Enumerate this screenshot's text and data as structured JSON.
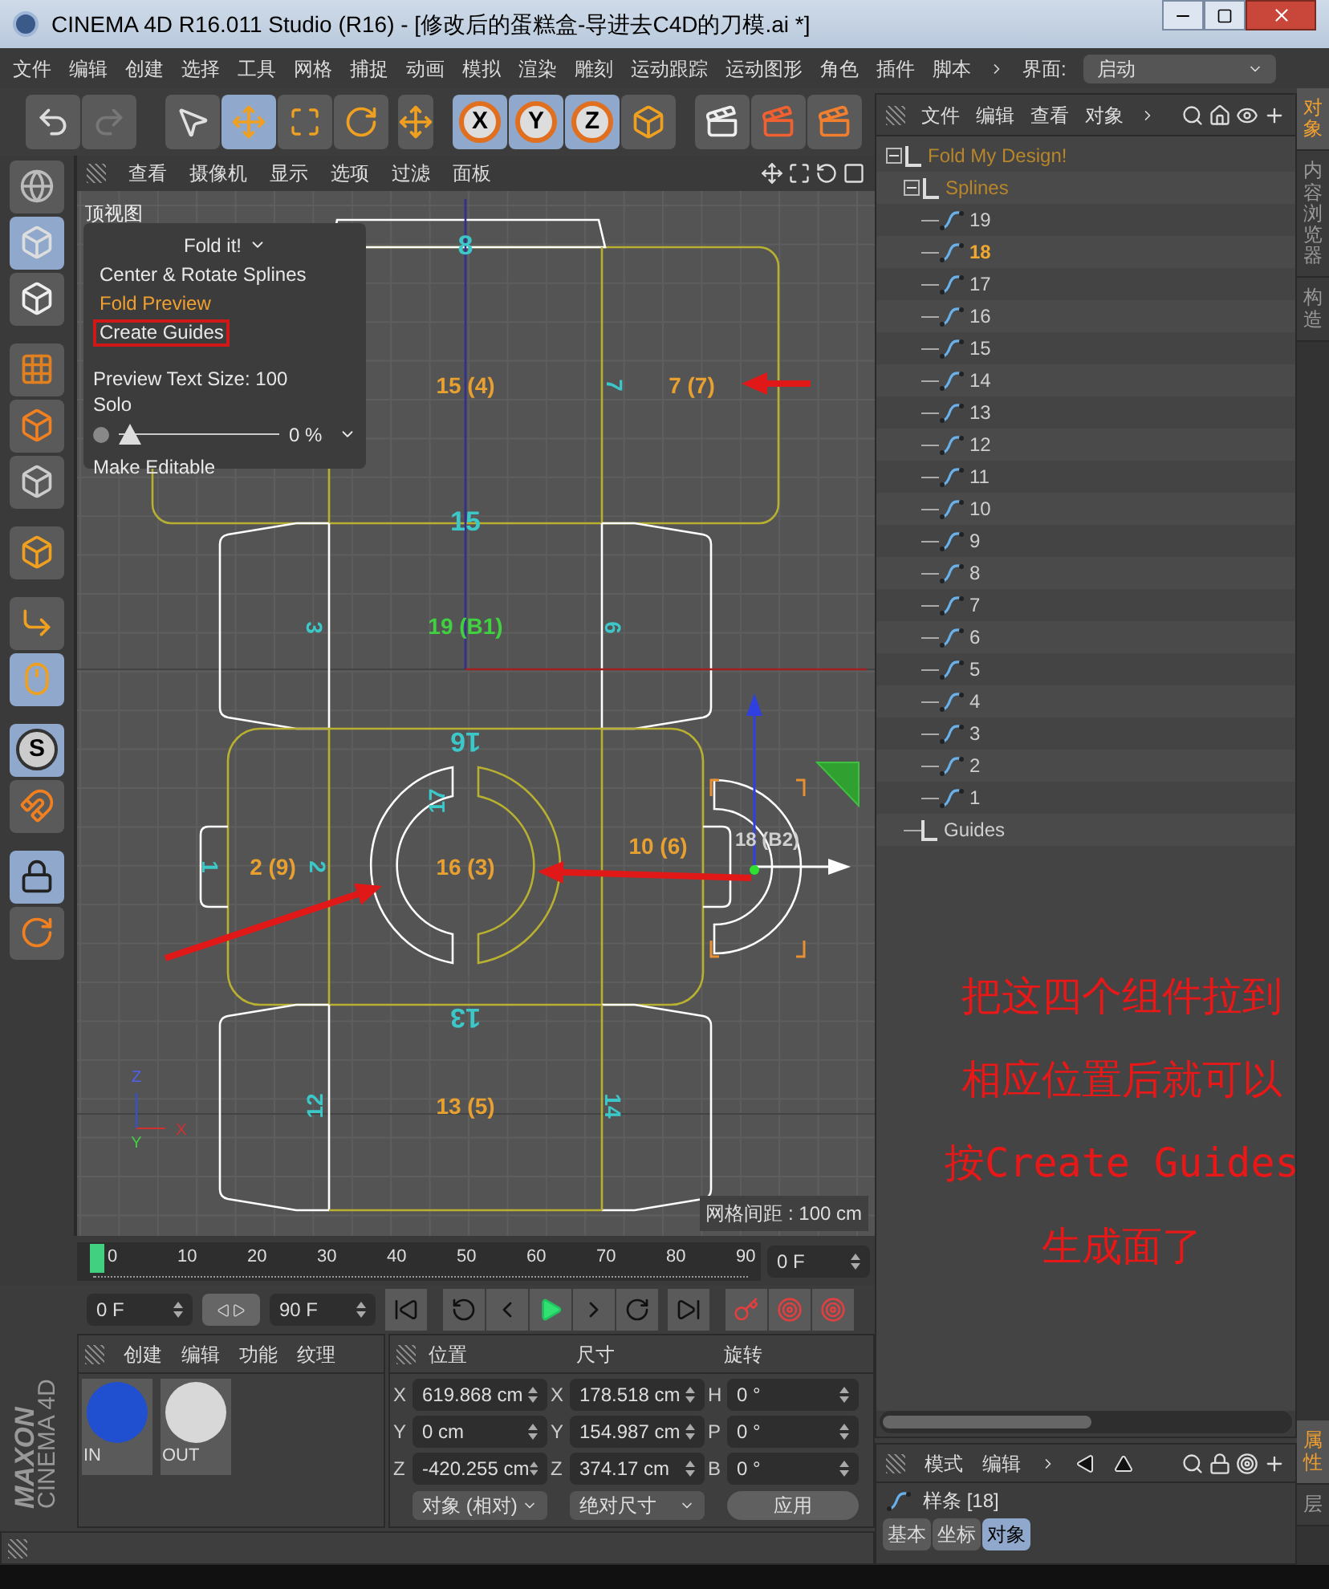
{
  "window": {
    "title": "CINEMA 4D R16.011 Studio (R16) - [修改后的蛋糕盒-导进去C4D的刀模.ai *]"
  },
  "menu": {
    "items": [
      "文件",
      "编辑",
      "创建",
      "选择",
      "工具",
      "网格",
      "捕捉",
      "动画",
      "模拟",
      "渲染",
      "雕刻",
      "运动跟踪",
      "运动图形",
      "角色",
      "插件",
      "脚本"
    ],
    "layout_label": "界面:",
    "layout_value": "启动"
  },
  "toolbar": {
    "tools": [
      {
        "selected": false
      },
      {
        "selected": true
      },
      {
        "selected": false
      },
      {
        "selected": false
      }
    ],
    "axes": [
      {
        "label": "X",
        "selected": true
      },
      {
        "label": "Y",
        "selected": true
      },
      {
        "label": "Z",
        "selected": true
      }
    ]
  },
  "left_tools": [
    {
      "selected": false
    },
    {
      "selected": true
    },
    {
      "selected": false
    },
    {
      "selected": false
    },
    {
      "selected": false
    },
    {
      "selected": false
    },
    {
      "selected": false
    },
    {
      "selected": false
    },
    {
      "selected": true
    },
    {
      "selected": true,
      "label": "S"
    },
    {
      "selected": false
    },
    {
      "selected": true
    },
    {
      "selected": false
    }
  ],
  "viewport": {
    "menu": [
      "查看",
      "摄像机",
      "显示",
      "选项",
      "过滤",
      "面板"
    ],
    "view_name": "顶视图",
    "grid_note": "网格间距 : 100 cm",
    "labels": [
      {
        "text": "8",
        "color": "#3cc8c8"
      },
      {
        "text": "15 (4)",
        "color": "#e8a030"
      },
      {
        "text": "7",
        "color": "#3cc8c8"
      },
      {
        "text": "7 (7)",
        "color": "#e8a030"
      },
      {
        "text": "15",
        "color": "#3cc8c8"
      },
      {
        "text": "3",
        "color": "#3cc8c8"
      },
      {
        "text": "19 (B1)",
        "color": "#40d040"
      },
      {
        "text": "6",
        "color": "#3cc8c8"
      },
      {
        "text": "16",
        "color": "#3cc8c8"
      },
      {
        "text": "17",
        "color": "#3cc8c8"
      },
      {
        "text": "1",
        "color": "#3cc8c8"
      },
      {
        "text": "2 (9)",
        "color": "#e8a030"
      },
      {
        "text": "2",
        "color": "#3cc8c8"
      },
      {
        "text": "16 (3)",
        "color": "#e8a030"
      },
      {
        "text": "10 (6)",
        "color": "#e8a030"
      },
      {
        "text": "18 (B2)",
        "color": "#d0d0d0"
      },
      {
        "text": "13",
        "color": "#3cc8c8"
      },
      {
        "text": "12",
        "color": "#3cc8c8"
      },
      {
        "text": "13 (5)",
        "color": "#e8a030"
      },
      {
        "text": "14",
        "color": "#3cc8c8"
      }
    ],
    "axis_letters": [
      "Z",
      "Y",
      "X"
    ],
    "fold_panel": {
      "title": "Fold it!",
      "items": [
        {
          "label": "Center & Rotate Splines",
          "selected": false,
          "highlighted": false
        },
        {
          "label": "Fold Preview",
          "selected": true,
          "highlighted": false
        },
        {
          "label": "Create Guides",
          "selected": false,
          "highlighted": true
        }
      ],
      "text_size": "Preview Text Size: 100",
      "solo": "Solo",
      "slider": {
        "level": 0,
        "reading": "0 %"
      },
      "make_editable": "Make Editable"
    }
  },
  "annotation": [
    "把这四个组件拉到",
    "相应位置后就可以",
    "按Create Guides",
    "生成面了"
  ],
  "timeline": {
    "ticks": [
      "0",
      "10",
      "20",
      "30",
      "40",
      "50",
      "60",
      "70",
      "80",
      "90"
    ],
    "playhead": {
      "level": 0
    },
    "current": "0 F"
  },
  "transport": {
    "start": "0 F",
    "end": "90 F"
  },
  "materials": {
    "menu": [
      "创建",
      "编辑",
      "功能",
      "纹理"
    ],
    "items": [
      {
        "name": "IN",
        "color": "#2050d0"
      },
      {
        "name": "OUT",
        "color": "#d8d8d8"
      }
    ]
  },
  "coordinates": {
    "headers": [
      "位置",
      "尺寸",
      "旋转"
    ],
    "rows": [
      {
        "axis": "X",
        "position": "619.868 cm",
        "size_axis": "X",
        "size": "178.518 cm",
        "rot_axis": "H",
        "rotation": "0 °"
      },
      {
        "axis": "Y",
        "position": "0 cm",
        "size_axis": "Y",
        "size": "154.987 cm",
        "rot_axis": "P",
        "rotation": "0 °"
      },
      {
        "axis": "Z",
        "position": "-420.255 cm",
        "size_axis": "Z",
        "size": "374.17 cm",
        "rot_axis": "B",
        "rotation": "0 °"
      }
    ],
    "mode": "对象 (相对)",
    "size_mode": "绝对尺寸",
    "apply": "应用"
  },
  "logo": {
    "brand": "MAXON",
    "product": "CINEMA 4D"
  },
  "object_manager": {
    "menu": [
      "文件",
      "编辑",
      "查看",
      "对象"
    ],
    "tree": [
      {
        "name": "Fold My Design!",
        "kind": "null",
        "selected": false,
        "expanded": true,
        "children": [
          {
            "name": "Splines",
            "kind": "null",
            "selected": false,
            "expanded": true,
            "children": [
              {
                "name": "19",
                "kind": "spline",
                "selected": false
              },
              {
                "name": "18",
                "kind": "spline",
                "selected": true
              },
              {
                "name": "17",
                "kind": "spline",
                "selected": false
              },
              {
                "name": "16",
                "kind": "spline",
                "selected": false
              },
              {
                "name": "15",
                "kind": "spline",
                "selected": false
              },
              {
                "name": "14",
                "kind": "spline",
                "selected": false
              },
              {
                "name": "13",
                "kind": "spline",
                "selected": false
              },
              {
                "name": "12",
                "kind": "spline",
                "selected": false
              },
              {
                "name": "11",
                "kind": "spline",
                "selected": false
              },
              {
                "name": "10",
                "kind": "spline",
                "selected": false
              },
              {
                "name": "9",
                "kind": "spline",
                "selected": false
              },
              {
                "name": "8",
                "kind": "spline",
                "selected": false
              },
              {
                "name": "7",
                "kind": "spline",
                "selected": false
              },
              {
                "name": "6",
                "kind": "spline",
                "selected": false
              },
              {
                "name": "5",
                "kind": "spline",
                "selected": false
              },
              {
                "name": "4",
                "kind": "spline",
                "selected": false
              },
              {
                "name": "3",
                "kind": "spline",
                "selected": false
              },
              {
                "name": "2",
                "kind": "spline",
                "selected": false
              },
              {
                "name": "1",
                "kind": "spline",
                "selected": false
              }
            ]
          },
          {
            "name": "Guides",
            "kind": "null",
            "selected": false
          }
        ]
      }
    ]
  },
  "side_tabs_top": [
    {
      "label": "对象",
      "selected": true
    },
    {
      "label": "内容浏览器",
      "selected": false
    },
    {
      "label": "构造",
      "selected": false
    }
  ],
  "attributes": {
    "menu": [
      "模式",
      "编辑"
    ],
    "object": "样条 [18]",
    "tabs": [
      {
        "label": "基本",
        "selected": false
      },
      {
        "label": "坐标",
        "selected": false
      },
      {
        "label": "对象",
        "selected": true
      }
    ]
  },
  "side_tabs_bottom": [
    {
      "label": "属性",
      "selected": true
    },
    {
      "label": "层",
      "selected": false
    }
  ]
}
